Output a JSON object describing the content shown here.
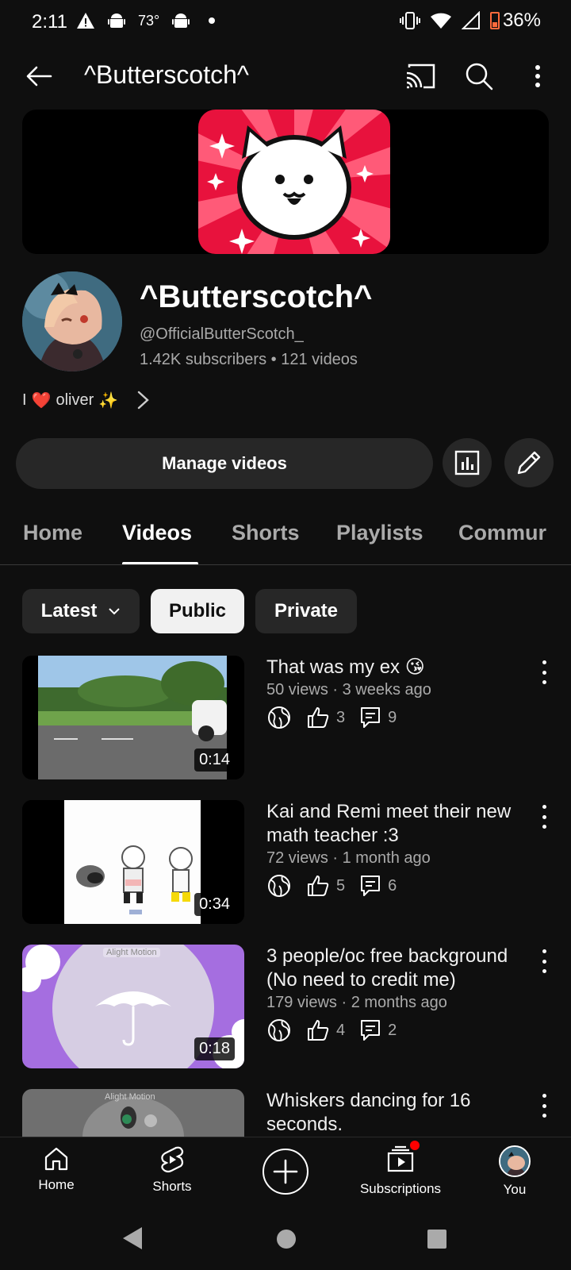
{
  "status_bar": {
    "time": "2:11",
    "temperature": "73°",
    "battery": "36%"
  },
  "appbar": {
    "title": "^Butterscotch^"
  },
  "channel": {
    "name": "^Butterscotch^",
    "handle": "@OfficialButterScotch_",
    "stats": "1.42K subscribers • 121 videos",
    "bio_prefix": "I",
    "bio_heart": "❤️",
    "bio_name": "oliver",
    "bio_sparkle": "✨"
  },
  "actions": {
    "manage_videos": "Manage videos"
  },
  "tabs": [
    {
      "label": "Home"
    },
    {
      "label": "Videos"
    },
    {
      "label": "Shorts"
    },
    {
      "label": "Playlists"
    },
    {
      "label": "Commur"
    }
  ],
  "filters": {
    "sort": "Latest",
    "public": "Public",
    "private": "Private"
  },
  "videos": [
    {
      "title": "That was my ex 😘",
      "meta": "50 views · 3 weeks ago",
      "likes": "3",
      "comments": "9",
      "duration": "0:14"
    },
    {
      "title": "Kai and Remi meet their new math teacher :3",
      "meta": "72 views · 1 month ago",
      "likes": "5",
      "comments": "6",
      "duration": "0:34"
    },
    {
      "title": "3 people/oc free background (No need to credit me)",
      "meta": "179 views · 2 months ago",
      "likes": "4",
      "comments": "2",
      "duration": "0:18",
      "watermark": "Alight Motion"
    },
    {
      "title": "Whiskers dancing for 16 seconds.",
      "watermark": "Alight Motion"
    }
  ],
  "bottom_nav": {
    "home": "Home",
    "shorts": "Shorts",
    "subscriptions": "Subscriptions",
    "you": "You"
  },
  "colors": {
    "background": "#0f0f0f",
    "surface": "#272727",
    "secondary_text": "#aaaaaa",
    "notification_dot": "#ff0000"
  }
}
